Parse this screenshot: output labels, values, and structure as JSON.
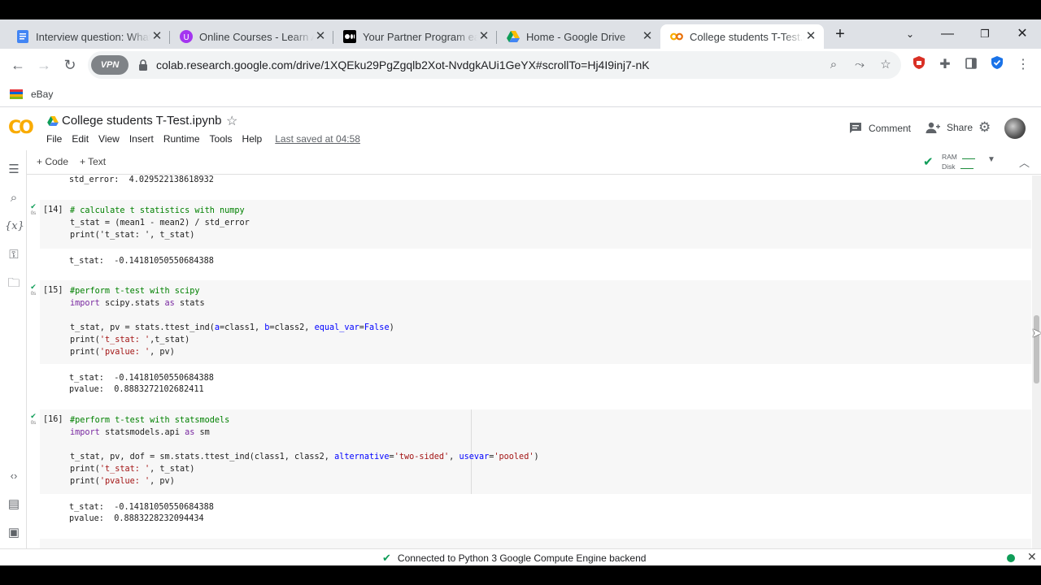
{
  "browser": {
    "tabs": [
      {
        "label": "Interview question: What",
        "icon": "docs-icon"
      },
      {
        "label": "Online Courses - Learn A",
        "icon": "udemy-icon"
      },
      {
        "label": "Your Partner Program ea",
        "icon": "medium-icon"
      },
      {
        "label": "Home - Google Drive",
        "icon": "drive-icon"
      },
      {
        "label": "College students T-Test.i",
        "icon": "colab-icon"
      }
    ],
    "new_tab": "+",
    "vpn_label": "VPN",
    "url": "colab.research.google.com/drive/1XQEku29PgZgqlb2Xot-NvdgkAUi1GeYX#scrollTo=Hj4I9inj7-nK",
    "bookmarks": [
      {
        "label": "eBay"
      }
    ]
  },
  "colab": {
    "logo": "CO",
    "title": "College students T-Test.ipynb",
    "menu": [
      "File",
      "Edit",
      "View",
      "Insert",
      "Runtime",
      "Tools",
      "Help"
    ],
    "last_saved": "Last saved at 04:58",
    "comment_label": "Comment",
    "share_label": "Share",
    "add_code": "+ Code",
    "add_text": "+ Text",
    "ram_label": "RAM",
    "disk_label": "Disk"
  },
  "notebook": {
    "top_output": "std_error:  4.029522138618932",
    "cells": [
      {
        "number": "[14]",
        "time": "0s",
        "code": [
          "# calculate t statistics with numpy",
          "t_stat = (mean1 - mean2) / std_error",
          "print('t_stat: ', t_stat)"
        ],
        "output": [
          "t_stat:  -0.14181050550684388"
        ]
      },
      {
        "number": "[15]",
        "time": "0s",
        "code": [
          "#perform t-test with scipy",
          "import scipy.stats as stats",
          "",
          "t_stat, pv = stats.ttest_ind(a=class1, b=class2, equal_var=False)",
          "print('t_stat: ',t_stat)",
          "print('pvalue: ', pv)"
        ],
        "output": [
          "t_stat:  -0.14181050550684388",
          "pvalue:  0.8883272102682411"
        ]
      },
      {
        "number": "[16]",
        "time": "0s",
        "code": [
          "#perform t-test with statsmodels",
          "import statsmodels.api as sm",
          "",
          "t_stat, pv, dof = sm.stats.ttest_ind(class1, class2, alternative='two-sided', usevar='pooled')",
          "print('t_stat: ', t_stat)",
          "print('pvalue: ', pv)"
        ],
        "output": [
          "t_stat:  -0.14181050550684388",
          "pvalue:  0.8883228232094434"
        ]
      }
    ]
  },
  "status": {
    "text": "Connected to Python 3 Google Compute Engine backend"
  }
}
